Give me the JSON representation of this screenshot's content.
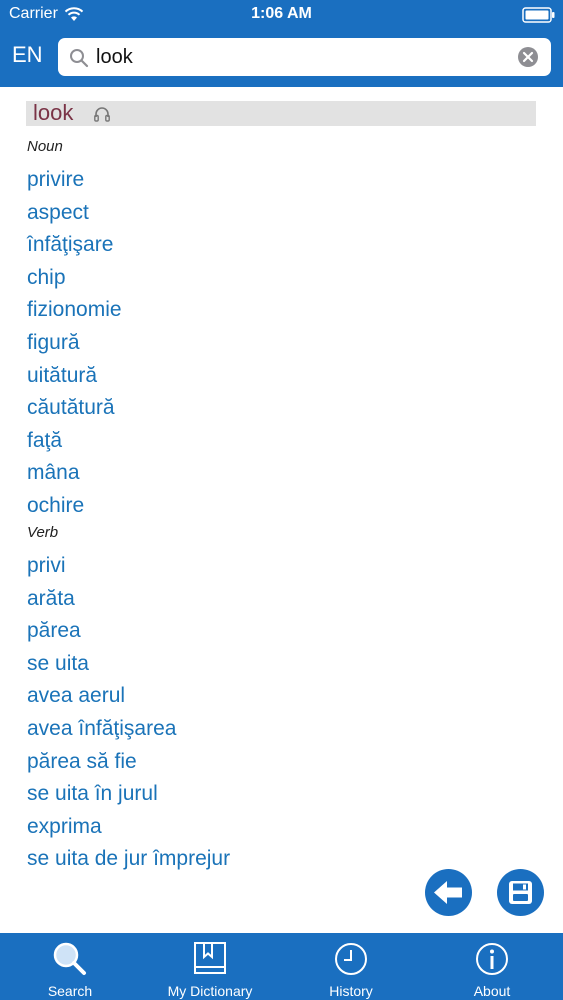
{
  "status_bar": {
    "carrier": "Carrier",
    "time": "1:06 AM"
  },
  "header": {
    "lang": "EN",
    "search_value": "look"
  },
  "entry": {
    "headword": "look",
    "noun_label": "Noun",
    "noun_translations": [
      "privire",
      "aspect",
      "înfăţişare",
      "chip",
      "fizionomie",
      "figură",
      "uitătură",
      "căutătură",
      "faţă",
      "mâna",
      "ochire"
    ],
    "verb_label": "Verb",
    "verb_translations": [
      "privi",
      "arăta",
      "părea",
      "se uita",
      "avea aerul",
      "avea înfăţişarea",
      "părea să fie",
      "se uita în jurul",
      "exprima",
      "se uita de jur împrejur"
    ]
  },
  "tabs": [
    {
      "label": "Search",
      "icon": "search-icon"
    },
    {
      "label": "My Dictionary",
      "icon": "book-icon"
    },
    {
      "label": "History",
      "icon": "clock-icon"
    },
    {
      "label": "About",
      "icon": "info-icon"
    }
  ],
  "colors": {
    "brand_blue": "#1a6fc0",
    "link_blue": "#1a73b8",
    "headword": "#7a3346",
    "headword_bg": "#e2e2e2"
  }
}
